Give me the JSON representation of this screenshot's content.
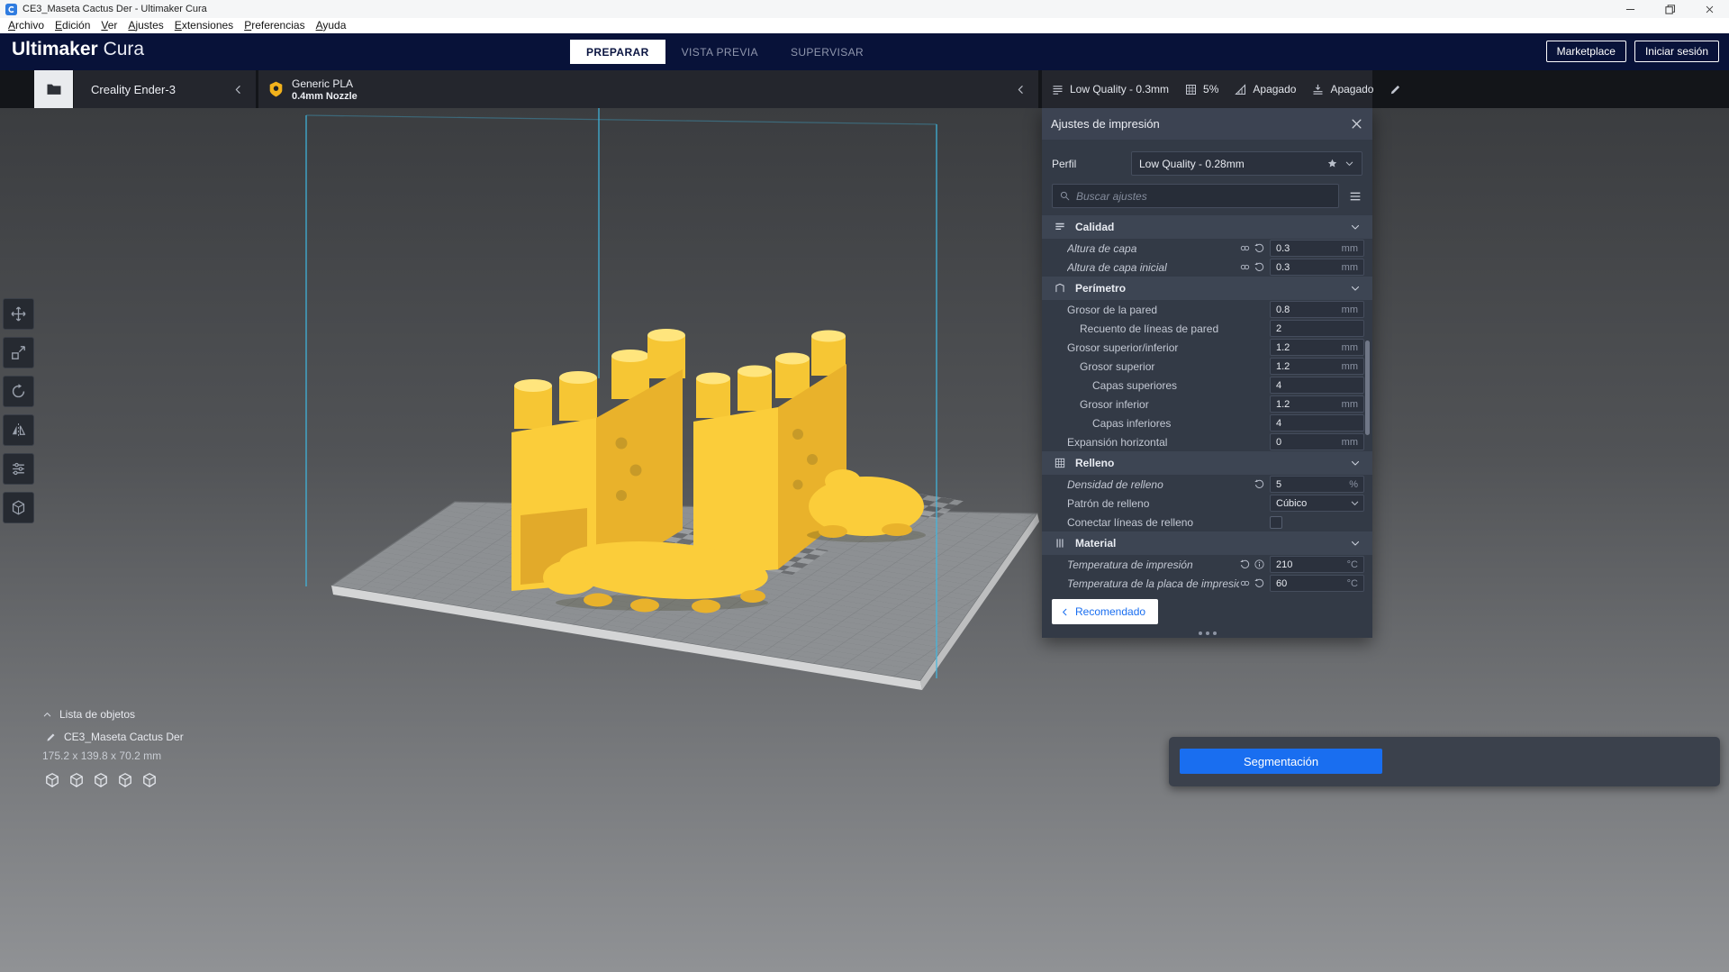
{
  "colors": {
    "accent_blue": "#196ef0",
    "header_navy": "#081239",
    "model_yellow": "#fbcd3a",
    "build_line_blue": "#3fb9e3",
    "panel_bg": "#333a46",
    "toolbar_bg": "#131519"
  },
  "window": {
    "title": "CE3_Maseta Cactus Der - Ultimaker Cura"
  },
  "menu": {
    "items": [
      "Archivo",
      "Edición",
      "Ver",
      "Ajustes",
      "Extensiones",
      "Preferencias",
      "Ayuda"
    ]
  },
  "header": {
    "brand_bold": "Ultimaker",
    "brand_light": "Cura",
    "tabs": [
      {
        "label": "PREPARAR",
        "active": true
      },
      {
        "label": "VISTA PREVIA",
        "active": false
      },
      {
        "label": "SUPERVISAR",
        "active": false
      }
    ],
    "marketplace": "Marketplace",
    "sign_in": "Iniciar sesión"
  },
  "toolbar": {
    "printer": "Creality Ender-3",
    "material": "Generic PLA",
    "nozzle": "0.4mm Nozzle",
    "summary": [
      {
        "icon": "profile",
        "text": "Low Quality - 0.3mm"
      },
      {
        "icon": "infill",
        "text": "5%"
      },
      {
        "icon": "support",
        "text": "Apagado"
      },
      {
        "icon": "adhesion",
        "text": "Apagado"
      }
    ]
  },
  "settings_panel": {
    "title": "Ajustes de impresión",
    "profile_label": "Perfil",
    "profile_value": "Low Quality - 0.28mm",
    "search_placeholder": "Buscar ajustes",
    "rows": [
      {
        "type": "category",
        "icon": "quality",
        "label": "Calidad"
      },
      {
        "type": "setting",
        "label": "Altura de capa",
        "italic": true,
        "icons": [
          "link",
          "revert"
        ],
        "value": "0.3",
        "unit": "mm"
      },
      {
        "type": "setting",
        "label": "Altura de capa inicial",
        "italic": true,
        "icons": [
          "link",
          "revert"
        ],
        "value": "0.3",
        "unit": "mm"
      },
      {
        "type": "category",
        "icon": "perimeter",
        "label": "Perímetro"
      },
      {
        "type": "setting",
        "label": "Grosor de la pared",
        "value": "0.8",
        "unit": "mm"
      },
      {
        "type": "setting",
        "label": "Recuento de líneas de pared",
        "indent": 1,
        "value": "2"
      },
      {
        "type": "setting",
        "label": "Grosor superior/inferior",
        "value": "1.2",
        "unit": "mm"
      },
      {
        "type": "setting",
        "label": "Grosor superior",
        "indent": 1,
        "value": "1.2",
        "unit": "mm"
      },
      {
        "type": "setting",
        "label": "Capas superiores",
        "indent": 2,
        "value": "4"
      },
      {
        "type": "setting",
        "label": "Grosor inferior",
        "indent": 1,
        "value": "1.2",
        "unit": "mm"
      },
      {
        "type": "setting",
        "label": "Capas inferiores",
        "indent": 2,
        "value": "4"
      },
      {
        "type": "setting",
        "label": "Expansión horizontal",
        "value": "0",
        "unit": "mm"
      },
      {
        "type": "category",
        "icon": "infill",
        "label": "Relleno"
      },
      {
        "type": "setting",
        "label": "Densidad de relleno",
        "italic": true,
        "icons": [
          "revert"
        ],
        "value": "5",
        "unit": "%"
      },
      {
        "type": "setting",
        "label": "Patrón de relleno",
        "control": "dropdown",
        "value": "Cúbico"
      },
      {
        "type": "setting",
        "label": "Conectar líneas de relleno",
        "control": "checkbox",
        "checked": false
      },
      {
        "type": "category",
        "icon": "material",
        "label": "Material"
      },
      {
        "type": "setting",
        "label": "Temperatura de impresión",
        "italic": true,
        "icons": [
          "revert",
          "info"
        ],
        "value": "210",
        "unit": "°C"
      },
      {
        "type": "setting",
        "label": "Temperatura de la placa de impresión",
        "italic": true,
        "icons": [
          "link",
          "revert"
        ],
        "value": "60",
        "unit": "°C"
      }
    ],
    "recommended": "Recomendado"
  },
  "left_toolbar": {
    "tools": [
      {
        "name": "move"
      },
      {
        "name": "scale"
      },
      {
        "name": "rotate"
      },
      {
        "name": "mirror"
      },
      {
        "name": "per-model-settings"
      },
      {
        "name": "support-blocker"
      }
    ]
  },
  "object_list": {
    "toggle_label": "Lista de objetos",
    "object_name": "CE3_Maseta Cactus Der",
    "dimensions": "175.2 x 139.8 x 70.2 mm",
    "view_buttons": [
      "view-3d",
      "view-front",
      "view-top",
      "view-left",
      "view-right"
    ]
  },
  "action_panel": {
    "slice_button": "Segmentación"
  }
}
